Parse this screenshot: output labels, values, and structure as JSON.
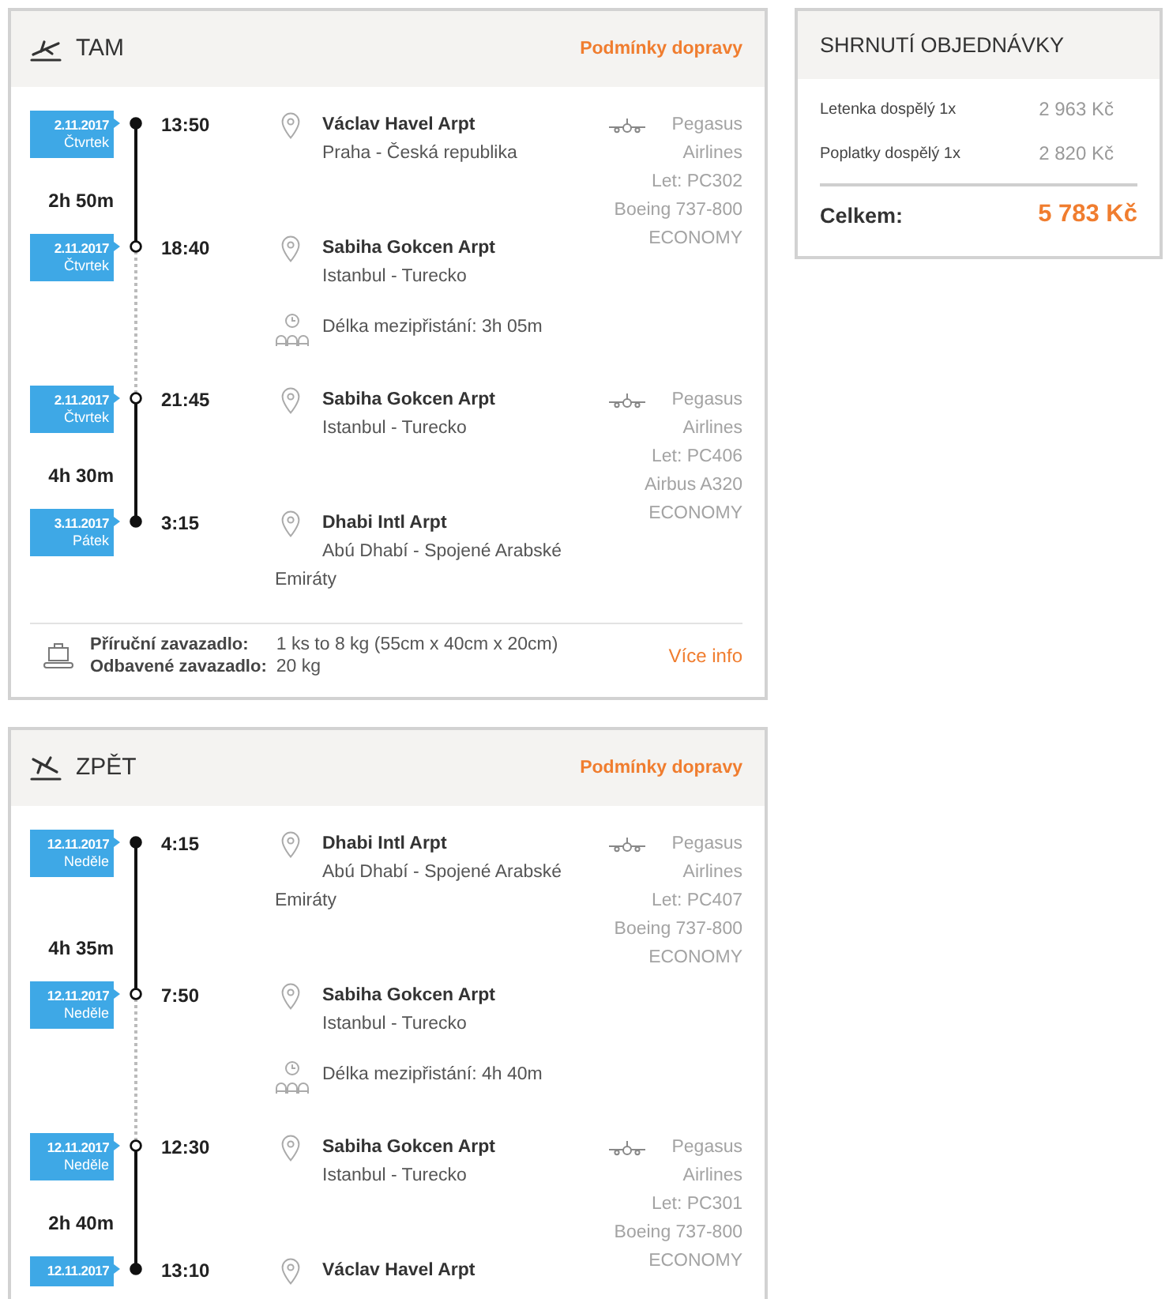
{
  "itineraries": [
    {
      "kind": "departure",
      "title": "TAM",
      "conditions_link": "Podmínky dopravy",
      "timeline": [
        {
          "kind": "flight",
          "departure": {
            "date": "2.11.2017",
            "weekday": "Čtvrtek",
            "time": "13:50",
            "airport": "Václav Havel Arpt",
            "city": "Praha - Česká republika",
            "transfer": false
          },
          "duration": "2h 50m",
          "arrival": {
            "date": "2.11.2017",
            "weekday": "Čtvrtek",
            "time": "18:40",
            "airport": "Sabiha Gokcen Arpt",
            "city": "Istanbul - Turecko",
            "transfer": true
          },
          "airline": "Pegasus Airlines",
          "flight_number": "Let: PC302",
          "aircraft": "Boeing 737-800",
          "cabin": "ECONOMY"
        },
        {
          "kind": "layover",
          "text": "Délka mezipřistání: 3h 05m"
        },
        {
          "kind": "flight",
          "departure": {
            "date": "2.11.2017",
            "weekday": "Čtvrtek",
            "time": "21:45",
            "airport": "Sabiha Gokcen Arpt",
            "city": "Istanbul - Turecko",
            "transfer": true
          },
          "duration": "4h 30m",
          "arrival": {
            "date": "3.11.2017",
            "weekday": "Pátek",
            "time": "3:15",
            "airport": "Dhabi Intl Arpt",
            "city": "Abú Dhabí - Spojené Arabské Emiráty",
            "transfer": false
          },
          "airline": "Pegasus Airlines",
          "flight_number": "Let: PC406",
          "aircraft": "Airbus A320",
          "cabin": "ECONOMY"
        }
      ],
      "baggage": {
        "rows": [
          {
            "label": "Příruční zavazadlo:",
            "value": "1 ks to 8 kg (55cm x 40cm x 20cm)"
          },
          {
            "label": "Odbavené zavazadlo:",
            "value": "20 kg"
          }
        ],
        "more_link": "Více info"
      }
    },
    {
      "kind": "return",
      "title": "ZPĚT",
      "conditions_link": "Podmínky dopravy",
      "timeline": [
        {
          "kind": "flight",
          "departure": {
            "date": "12.11.2017",
            "weekday": "Neděle",
            "time": "4:15",
            "airport": "Dhabi Intl Arpt",
            "city": "Abú Dhabí - Spojené Arabské Emiráty",
            "transfer": false
          },
          "duration": "4h 35m",
          "arrival": {
            "date": "12.11.2017",
            "weekday": "Neděle",
            "time": "7:50",
            "airport": "Sabiha Gokcen Arpt",
            "city": "Istanbul - Turecko",
            "transfer": true
          },
          "airline": "Pegasus Airlines",
          "flight_number": "Let: PC407",
          "aircraft": "Boeing 737-800",
          "cabin": "ECONOMY"
        },
        {
          "kind": "layover",
          "text": "Délka mezipřistání: 4h 40m"
        },
        {
          "kind": "flight",
          "departure": {
            "date": "12.11.2017",
            "weekday": "Neděle",
            "time": "12:30",
            "airport": "Sabiha Gokcen Arpt",
            "city": "Istanbul - Turecko",
            "transfer": true
          },
          "duration": "2h 40m",
          "arrival": {
            "date": "12.11.2017",
            "time": "13:10",
            "airport": "Václav Havel Arpt",
            "transfer": false
          },
          "airline": "Pegasus Airlines",
          "flight_number": "Let: PC301",
          "aircraft": "Boeing 737-800",
          "cabin": "ECONOMY"
        }
      ]
    }
  ],
  "summary": {
    "title": "SHRNUTÍ OBJEDNÁVKY",
    "items": [
      {
        "label": "Letenka dospělý 1x",
        "price": "2 963 Kč"
      },
      {
        "label": "Poplatky dospělý 1x",
        "price": "2 820 Kč"
      }
    ],
    "total_label": "Celkem:",
    "total": "5 783 Kč"
  }
}
